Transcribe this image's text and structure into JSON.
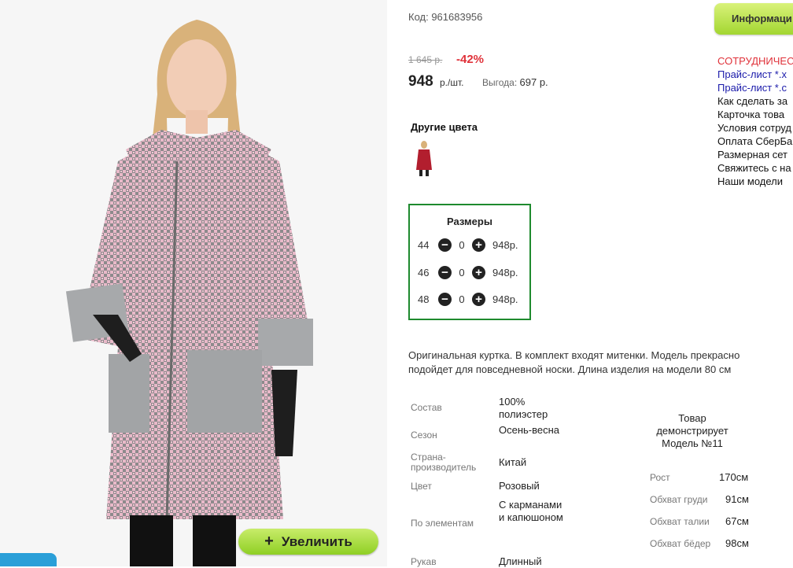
{
  "product": {
    "code": "Код: 961683956",
    "old_price": "1 645 р.",
    "discount": "-42%",
    "price": "948",
    "price_unit": "р./шт.",
    "benefit_label": "Выгода:",
    "benefit_value": "697 р."
  },
  "zoom_button": {
    "plus": "+",
    "label": "Увеличить"
  },
  "info_tab": {
    "label": "Информаци"
  },
  "other_colors": {
    "title": "Другие цвета"
  },
  "sizes": {
    "title": "Размеры",
    "minus": "−",
    "plus": "+",
    "rows": [
      {
        "size": "44",
        "qty": "0",
        "price": "948р."
      },
      {
        "size": "46",
        "qty": "0",
        "price": "948р."
      },
      {
        "size": "48",
        "qty": "0",
        "price": "948р."
      }
    ]
  },
  "description": "Оригинальная куртка. В комплект входят митенки. Модель прекрасно подойдет для повседневной носки. Длина изделия на модели 80 см",
  "specs": [
    {
      "label": "Состав",
      "value": "100% полиэстер"
    },
    {
      "label": "Сезон",
      "value": "Осень-весна"
    },
    {
      "label": "Страна-производитель",
      "value": "Китай"
    },
    {
      "label": "Цвет",
      "value": "Розовый"
    },
    {
      "label": "По элементам",
      "value": "С карманами и капюшоном"
    },
    {
      "label": "Рукав",
      "value": "Длинный"
    }
  ],
  "model": {
    "caption": "Товар демонстрирует Модель №11",
    "measures": [
      {
        "label": "Рост",
        "value": "170см"
      },
      {
        "label": "Обхват груди",
        "value": "91см"
      },
      {
        "label": "Обхват талии",
        "value": "67см"
      },
      {
        "label": "Обхват бёдер",
        "value": "98см"
      }
    ]
  },
  "right_links": [
    {
      "text": "СОТРУДНИЧЕСТ",
      "style": "red"
    },
    {
      "text": "Прайс-лист *.x",
      "style": "blue"
    },
    {
      "text": "Прайс-лист *.c",
      "style": "blue"
    },
    {
      "text": "Как сделать за",
      "style": "plain"
    },
    {
      "text": "Карточка това",
      "style": "plain"
    },
    {
      "text": "Условия сотруд",
      "style": "plain"
    },
    {
      "text": "Оплата СберБа",
      "style": "plain"
    },
    {
      "text": "Размерная сет",
      "style": "plain"
    },
    {
      "text": "Свяжитесь с на",
      "style": "plain"
    },
    {
      "text": "Наши модели",
      "style": "plain"
    }
  ],
  "colors": {
    "accent_green": "#1e8a2e",
    "discount_red": "#e0323a",
    "link_blue": "#1a1aaa",
    "zoom_button": "#a3d631"
  }
}
